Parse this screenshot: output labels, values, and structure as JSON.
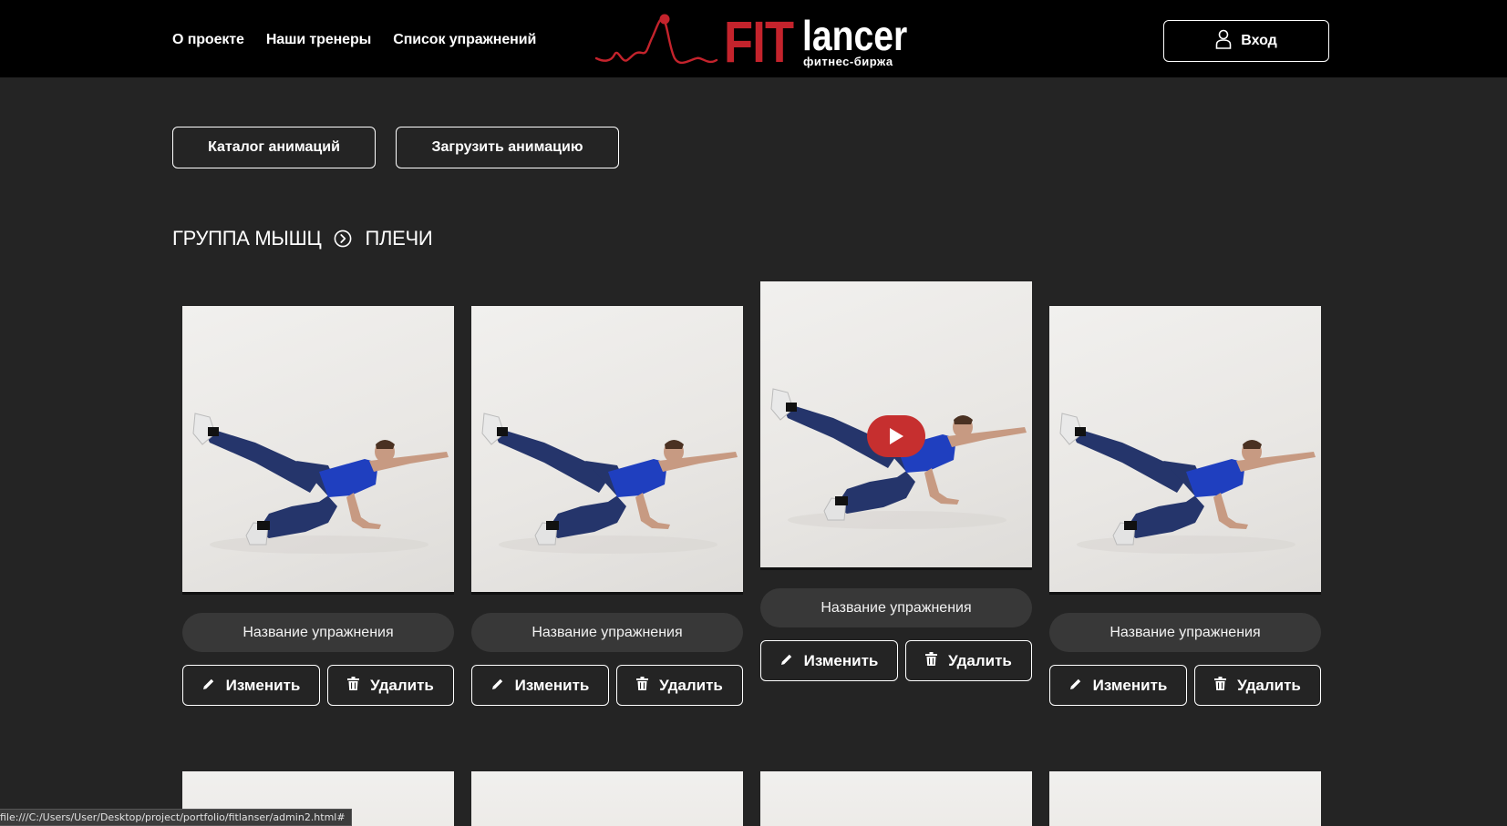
{
  "nav": {
    "items": [
      "О проекте",
      "Наши тренеры",
      "Список упражнений"
    ]
  },
  "logo": {
    "main_red": "FIT",
    "main_white": "lancer",
    "subtitle": "фитнес-биржа"
  },
  "login": {
    "label": "Вход"
  },
  "actions": {
    "catalog": "Каталог анимаций",
    "upload": "Загрузить анимацию"
  },
  "breadcrumb": {
    "root": "ГРУППА МЫШЦ",
    "current": "ПЛЕЧИ"
  },
  "cards": [
    {
      "name": "Название упражнения",
      "edit": "Изменить",
      "delete": "Удалить",
      "playing": false
    },
    {
      "name": "Название упражнения",
      "edit": "Изменить",
      "delete": "Удалить",
      "playing": false
    },
    {
      "name": "Название упражнения",
      "edit": "Изменить",
      "delete": "Удалить",
      "playing": true
    },
    {
      "name": "Название упражнения",
      "edit": "Изменить",
      "delete": "Удалить",
      "playing": false
    }
  ],
  "status_url": "file:///C:/Users/User/Desktop/project/portfolio/fitlanser/admin2.html#",
  "colors": {
    "accent": "#c4232c",
    "background": "#242424",
    "header": "#000000",
    "pill": "#383838"
  },
  "icons": [
    "user-icon",
    "chevron-right-circle-icon",
    "pencil-icon",
    "trash-icon",
    "play-icon"
  ]
}
